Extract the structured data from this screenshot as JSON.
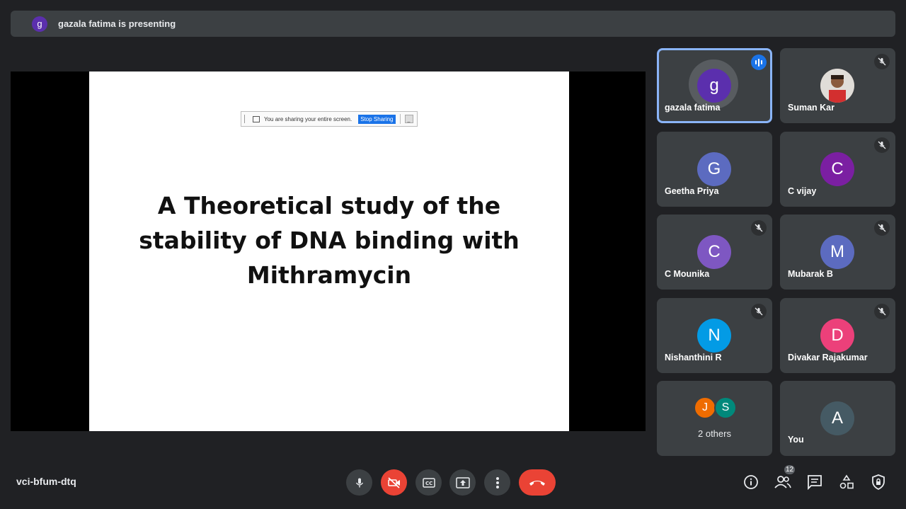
{
  "banner": {
    "avatar_letter": "g",
    "text": "gazala fatima is presenting"
  },
  "presentation": {
    "share_bar": {
      "text": "You are sharing your entire screen.",
      "stop_label": "Stop Sharing",
      "hide_label": "_"
    },
    "title": "A Theoretical study of the stability of DNA binding with Mithramycin"
  },
  "participants": [
    {
      "name": "gazala fatima",
      "letter": "g",
      "color": "#5b2fad",
      "speaking": true
    },
    {
      "name": "Suman Kar",
      "letter": "",
      "photo": true,
      "muted": true
    },
    {
      "name": "Geetha Priya",
      "letter": "G",
      "color": "#5c6bc0"
    },
    {
      "name": "C vijay",
      "letter": "C",
      "color": "#7b1fa2",
      "muted": true
    },
    {
      "name": "C Mounika",
      "letter": "C",
      "color": "#7e57c2",
      "muted": true
    },
    {
      "name": "Mubarak B",
      "letter": "M",
      "color": "#5c6bc0",
      "muted": true
    },
    {
      "name": "Nishanthini R",
      "letter": "N",
      "color": "#039be5",
      "muted": true
    },
    {
      "name": "Divakar Rajakumar",
      "letter": "D",
      "color": "#ec407a",
      "muted": true
    }
  ],
  "others": {
    "label": "2 others",
    "avatars": [
      {
        "letter": "J",
        "color": "#ef6c00"
      },
      {
        "letter": "S",
        "color": "#00897b"
      }
    ]
  },
  "self_tile": {
    "name": "You",
    "letter": "A",
    "color": "#455a64"
  },
  "meeting_code": "vci-bfum-dtq",
  "controls": [
    "microphone-icon",
    "camera-off-icon",
    "captions-icon",
    "present-icon",
    "more-options-icon",
    "end-call-icon"
  ],
  "right_controls": {
    "participant_count": "12",
    "icons": [
      "info-icon",
      "people-icon",
      "chat-icon",
      "activities-icon",
      "host-controls-icon"
    ]
  }
}
